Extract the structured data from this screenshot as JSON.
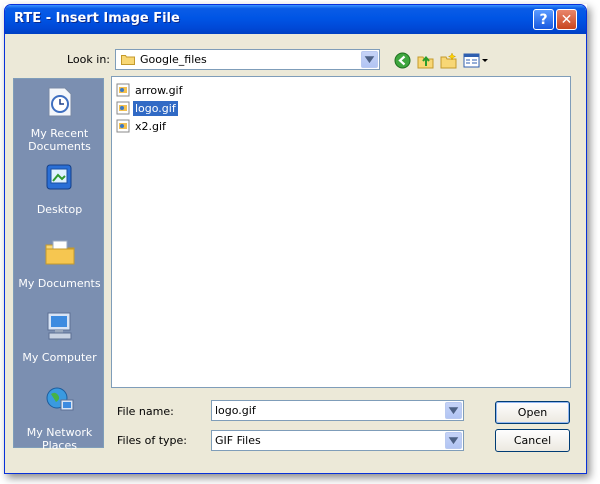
{
  "window": {
    "title": "RTE - Insert Image File",
    "help_label": "?",
    "close_label": "✕"
  },
  "toolbar": {
    "look_in_label": "Look in:",
    "look_in_value": "Google_files",
    "icons": [
      "back-icon",
      "up-folder-icon",
      "new-folder-icon",
      "views-menu-icon"
    ]
  },
  "places": [
    {
      "label": "My Recent Documents"
    },
    {
      "label": "Desktop"
    },
    {
      "label": "My Documents"
    },
    {
      "label": "My Computer"
    },
    {
      "label": "My Network Places"
    }
  ],
  "files": [
    {
      "name": "arrow.gif",
      "selected": false
    },
    {
      "name": "logo.gif",
      "selected": true
    },
    {
      "name": "x2.gif",
      "selected": false
    }
  ],
  "form": {
    "filename_label": "File name:",
    "filename_value": "logo.gif",
    "filetype_label": "Files of type:",
    "filetype_value": "GIF Files"
  },
  "buttons": {
    "open": "Open",
    "cancel": "Cancel"
  },
  "colors": {
    "titlebar": "#0055e5",
    "selection": "#316ac5",
    "places_panel": "#7b8fb1",
    "dialog_bg": "#ece9d8"
  }
}
